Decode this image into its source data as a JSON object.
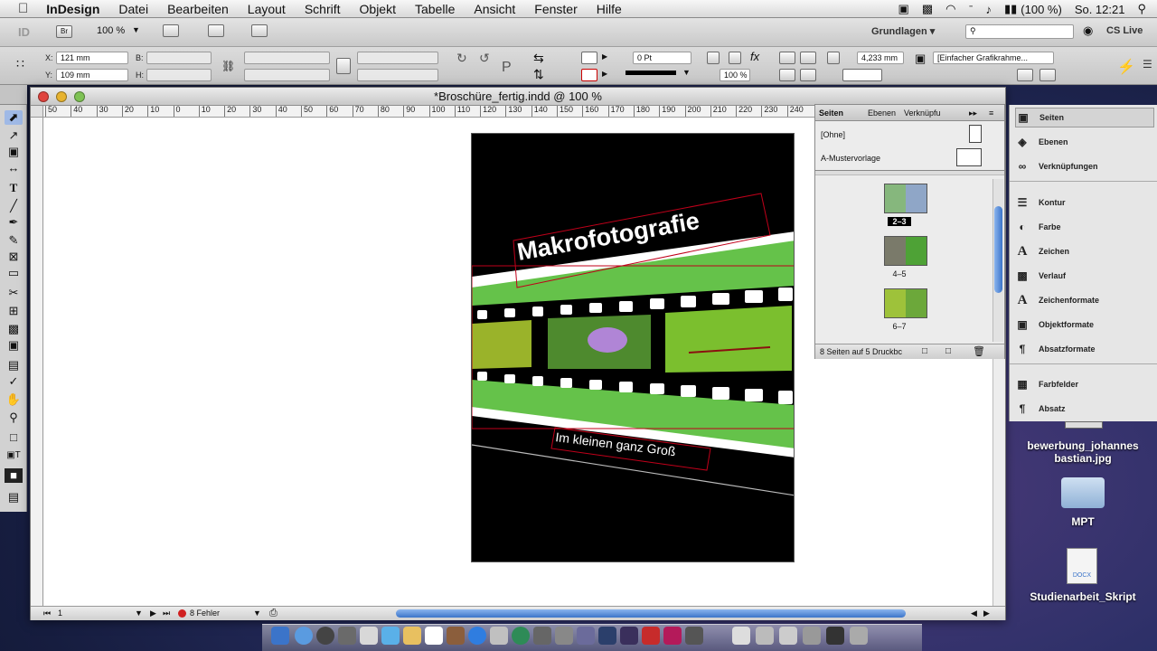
{
  "menubar": {
    "apple": "",
    "app": "InDesign",
    "items": [
      "Datei",
      "Bearbeiten",
      "Layout",
      "Schrift",
      "Objekt",
      "Tabelle",
      "Ansicht",
      "Fenster",
      "Hilfe"
    ],
    "battery": "(100 %)",
    "clock": "So. 12:21"
  },
  "appbar": {
    "zoom": "100 %",
    "workspace": "Grundlagen ▾",
    "cs_live": "CS Live",
    "bridge": "Br"
  },
  "control": {
    "x_label": "X:",
    "x_value": "121 mm",
    "y_label": "Y:",
    "y_value": "109 mm",
    "w_label": "B:",
    "h_label": "H:",
    "stroke_weight": "0 Pt",
    "scale": "100 %",
    "ref_value": "4,233 mm",
    "object_style": "[Einfacher Grafikrahme..."
  },
  "document": {
    "title": "*Broschüre_fertig.indd @ 100 %",
    "ruler_labels": [
      "50",
      "40",
      "30",
      "20",
      "10",
      "0",
      "10",
      "20",
      "30",
      "40",
      "50",
      "60",
      "70",
      "80",
      "90",
      "100",
      "110",
      "120",
      "130",
      "140",
      "150",
      "160",
      "170",
      "180",
      "190",
      "200",
      "210",
      "220",
      "230",
      "240"
    ],
    "page_heading": "Makrofotografie",
    "page_subtitle": "Im kleinen ganz Groß",
    "status": {
      "page": "1",
      "errors": "8 Fehler"
    }
  },
  "pages_panel": {
    "tabs": [
      "Seiten",
      "Ebenen",
      "Verknüpfu"
    ],
    "none_master": "[Ohne]",
    "a_master": "A-Mustervorlage",
    "spreads": [
      "2–3",
      "4–5",
      "6–7"
    ],
    "footer": "8 Seiten auf 5 Druckbc"
  },
  "dock_right": {
    "items": [
      "Seiten",
      "Ebenen",
      "Verknüpfungen",
      "Kontur",
      "Farbe",
      "Zeichen",
      "Verlauf",
      "Zeichenformate",
      "Objektformate",
      "Absatzformate",
      "Farbfelder",
      "Absatz"
    ]
  },
  "desktop_icons": [
    {
      "label": "bewerbung_johannes bastian.jpg"
    },
    {
      "label": "MPT"
    },
    {
      "label": "Studienarbeit_Skript"
    }
  ],
  "colors": {
    "accent": "#65c24a",
    "frame": "#c0001a",
    "bar": "#3b74c9"
  }
}
